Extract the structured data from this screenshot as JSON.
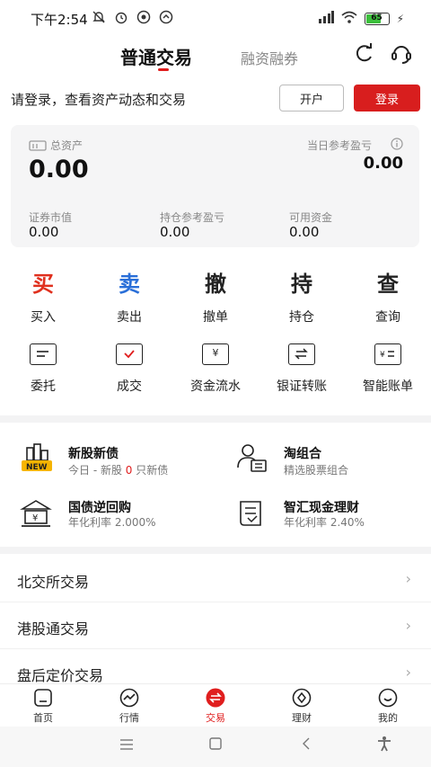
{
  "status_bar": {
    "time": "下午2:54",
    "battery": "65"
  },
  "header": {
    "tab_active": "普通交易",
    "tab_inactive": "融资融券"
  },
  "login": {
    "prompt": "请登录，查看资产动态和交易",
    "open_account": "开户",
    "login": "登录"
  },
  "assets": {
    "total_label": "总资产",
    "total_value": "0.00",
    "daily_pl_label": "当日参考盈亏",
    "daily_pl_value": "0.00",
    "market_value_label": "证券市值",
    "market_value": "0.00",
    "position_pl_label": "持仓参考盈亏",
    "position_pl": "0.00",
    "available_label": "可用资金",
    "available": "0.00"
  },
  "actions_row1": [
    {
      "glyph": "买",
      "label": "买入",
      "color": "#e0301e"
    },
    {
      "glyph": "卖",
      "label": "卖出",
      "color": "#2a6fd8"
    },
    {
      "glyph": "撤",
      "label": "撤单",
      "color": "#222222"
    },
    {
      "glyph": "持",
      "label": "持仓",
      "color": "#222222"
    },
    {
      "glyph": "查",
      "label": "查询",
      "color": "#222222"
    }
  ],
  "actions_row2": [
    {
      "label": "委托",
      "icon": "entrust-icon"
    },
    {
      "label": "成交",
      "icon": "deal-icon"
    },
    {
      "label": "资金流水",
      "icon": "cash-flow-icon"
    },
    {
      "label": "银证转账",
      "icon": "transfer-icon"
    },
    {
      "label": "智能账单",
      "icon": "bill-icon"
    }
  ],
  "features": {
    "ipo": {
      "title": "新股新债",
      "sub_prefix": "今日 - 新股 ",
      "sub_count": "0",
      "sub_suffix": " 只新债",
      "badge": "NEW"
    },
    "portfolio": {
      "title": "淘组合",
      "sub": "精选股票组合"
    },
    "repo": {
      "title": "国债逆回购",
      "sub": "年化利率 2.000%"
    },
    "cash": {
      "title": "智汇现金理财",
      "sub": "年化利率 2.40%"
    }
  },
  "list": [
    {
      "label": "北交所交易"
    },
    {
      "label": "港股通交易"
    },
    {
      "label": "盘后定价交易"
    }
  ],
  "bottom_nav": [
    {
      "label": "首页"
    },
    {
      "label": "行情"
    },
    {
      "label": "交易"
    },
    {
      "label": "理财"
    },
    {
      "label": "我的"
    }
  ],
  "colors": {
    "accent": "#d81e1e"
  }
}
